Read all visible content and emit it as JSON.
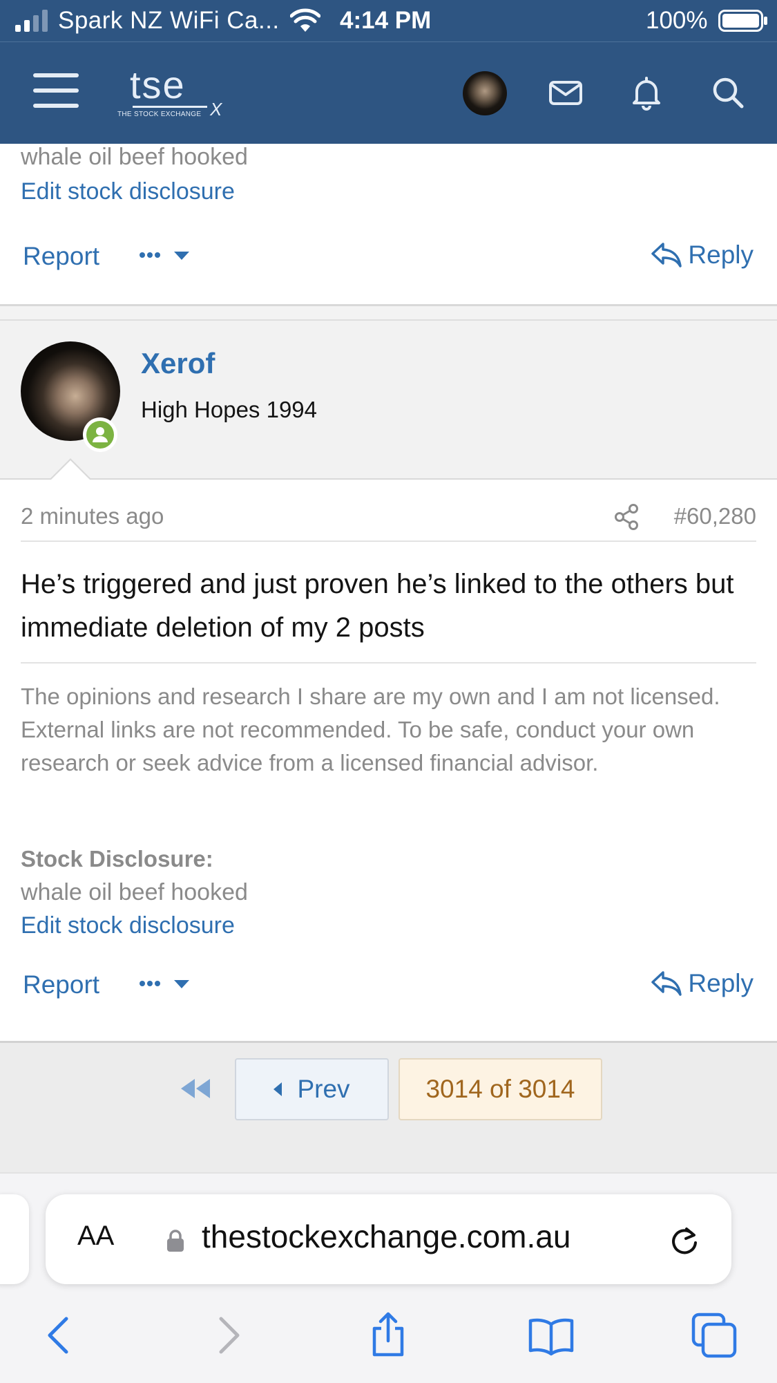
{
  "status_bar": {
    "carrier": "Spark NZ WiFi Ca...",
    "time": "4:14 PM",
    "battery": "100%"
  },
  "header": {
    "logo_text": "tse",
    "logo_subtitle": "THE STOCK EXCHANGE",
    "logo_mark": "X",
    "icons": [
      "menu-icon",
      "avatar",
      "mail-icon",
      "bell-icon",
      "search-icon"
    ],
    "brand_color": "#2e5582"
  },
  "previous_post": {
    "disclosure_text": "whale oil beef hooked",
    "edit_link": "Edit stock disclosure",
    "report_label": "Report",
    "reply_label": "Reply"
  },
  "post": {
    "username": "Xerof",
    "user_title": "High Hopes 1994",
    "timestamp": "2 minutes ago",
    "post_number": "#60,280",
    "message": "He’s triggered and just proven he’s linked to the others but immediate deletion of my 2 posts",
    "signature": "The opinions and research I share are my own and I am not licensed. External links are not recommended. To be safe, conduct your own research or seek advice from a licensed financial advisor.",
    "disclosure_label": "Stock Disclosure:",
    "disclosure_text": "whale oil beef hooked",
    "edit_link": "Edit stock disclosure",
    "report_label": "Report",
    "reply_label": "Reply",
    "online_status_color": "#7cb342"
  },
  "pagination": {
    "prev_label": "Prev",
    "page_indicator": "3014 of 3014"
  },
  "browser": {
    "text_size_button": "AA",
    "url": "thestockexchange.com.au",
    "toolbar_icons": [
      "back-icon",
      "forward-icon",
      "share-icon",
      "bookmarks-icon",
      "tabs-icon"
    ]
  },
  "colors": {
    "link": "#2f6fb0",
    "muted_text": "#8a8a8a",
    "page_indicator_text": "#a0661e"
  }
}
